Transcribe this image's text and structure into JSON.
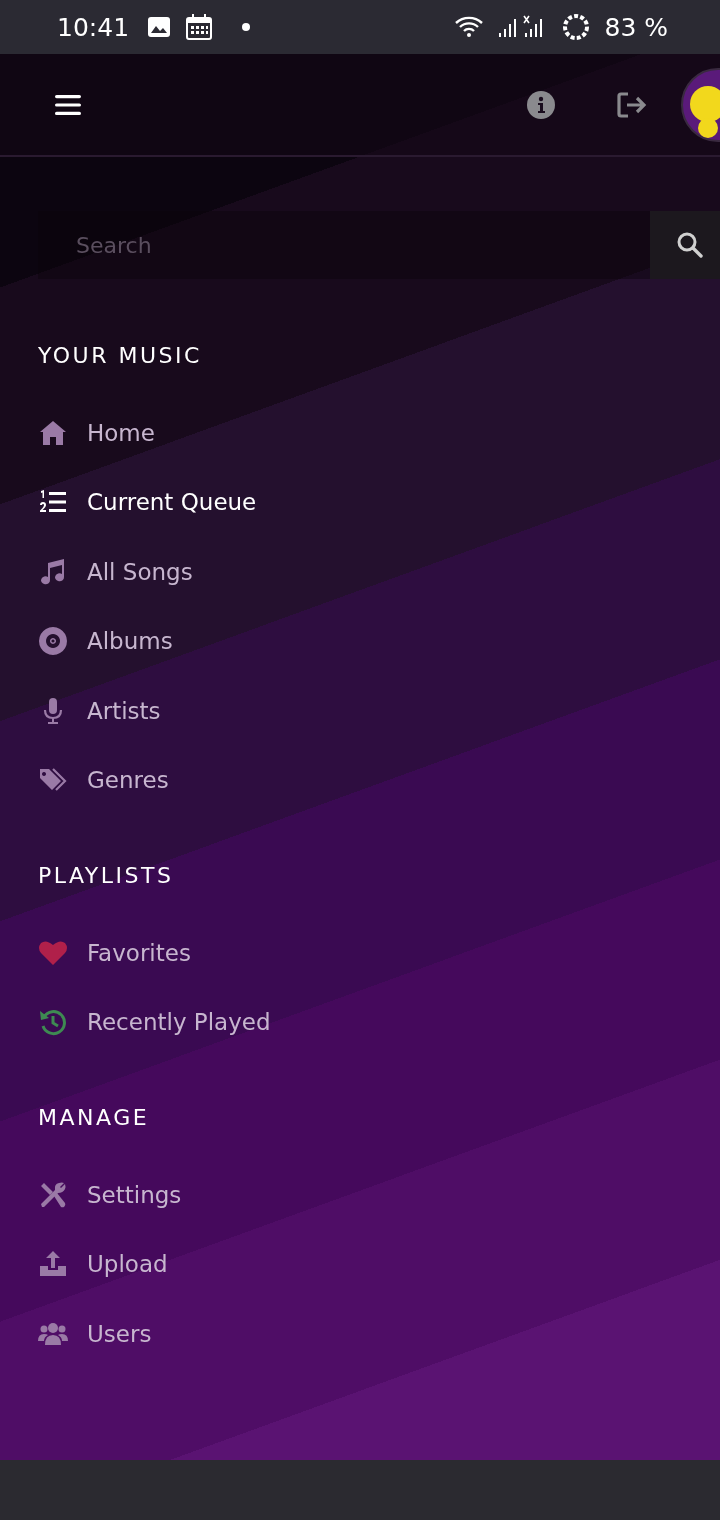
{
  "status_bar": {
    "time": "10:41",
    "battery": "83 %"
  },
  "search": {
    "placeholder": "Search"
  },
  "sections": [
    {
      "title": "YOUR MUSIC",
      "items": [
        {
          "label": "Home",
          "kind": "home",
          "selected": false
        },
        {
          "label": "Current Queue",
          "kind": "queue",
          "selected": true
        },
        {
          "label": "All Songs",
          "kind": "music",
          "selected": false
        },
        {
          "label": "Albums",
          "kind": "disc",
          "selected": false
        },
        {
          "label": "Artists",
          "kind": "mic",
          "selected": false
        },
        {
          "label": "Genres",
          "kind": "tags",
          "selected": false
        }
      ]
    },
    {
      "title": "PLAYLISTS",
      "items": [
        {
          "label": "Favorites",
          "kind": "heart",
          "selected": false
        },
        {
          "label": "Recently Played",
          "kind": "history",
          "selected": false
        }
      ]
    },
    {
      "title": "MANAGE",
      "items": [
        {
          "label": "Settings",
          "kind": "tools",
          "selected": false
        },
        {
          "label": "Upload",
          "kind": "upload",
          "selected": false
        },
        {
          "label": "Users",
          "kind": "users",
          "selected": false
        }
      ]
    }
  ]
}
